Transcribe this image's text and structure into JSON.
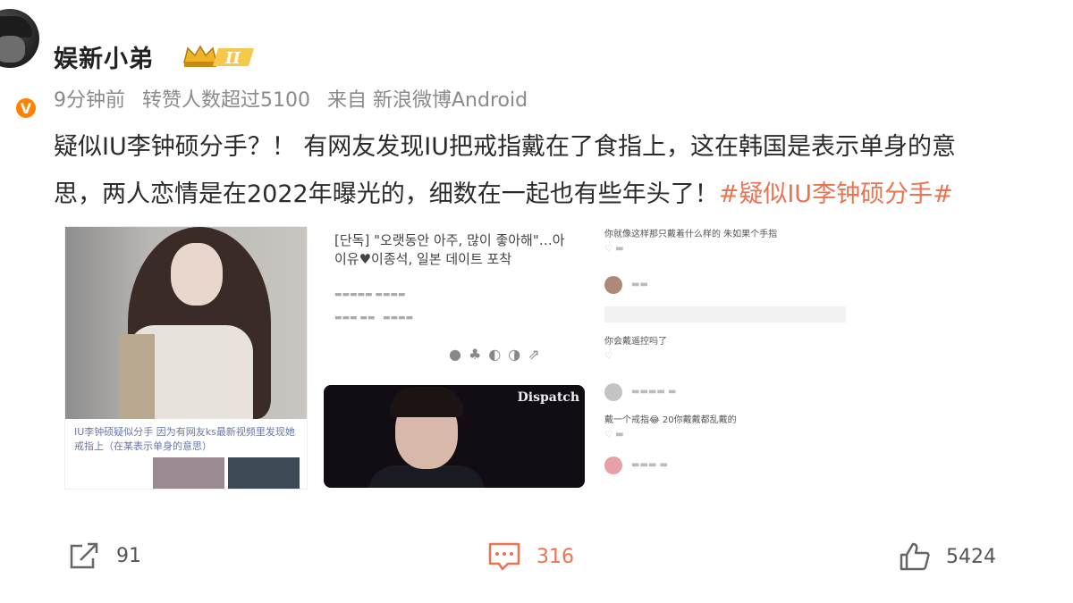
{
  "user": {
    "name": "娱新小弟",
    "level_badge": "II",
    "verified_mark": "V"
  },
  "meta": {
    "time": "9分钟前",
    "reposts_note": "转赞人数超过5100",
    "source": "来自 新浪微博Android"
  },
  "post": {
    "line1": "疑似IU李钟硕分手？！ 有网友发现IU把戒指戴在了食指上，这在韩国是表示单身的意",
    "line2": "思，两人恋情是在2022年曝光的，细数在一起也有些年头了！",
    "hashtag": "#疑似IU李钟硕分手#"
  },
  "image1": {
    "caption": "IU李钟硕疑似分手 因为有网友ks最新视频里发现她 戒指上（在某表示单身的意思）"
  },
  "image2": {
    "headline": "[단독] \"오랫동안 아주, 많이 좋아해\"…아이유♥이종석, 일본 데이트 포착",
    "logo": "Dispatch"
  },
  "image3": {
    "comment1": "你就像这样那只戴着什么样的 朱如果个手指",
    "comment2": "你会戴遥控吗了",
    "comment3": "戴一个戒指😂 20你戴戴都乱戴的"
  },
  "actions": {
    "share_count": "91",
    "comment_count": "316",
    "like_count": "5424"
  },
  "colors": {
    "hashtag": "#eb7350",
    "meta": "#8a8a8a",
    "verified": "#ff8200"
  },
  "icons": [
    "share-icon",
    "comment-icon",
    "like-icon",
    "crown-badge-icon",
    "verified-icon"
  ]
}
